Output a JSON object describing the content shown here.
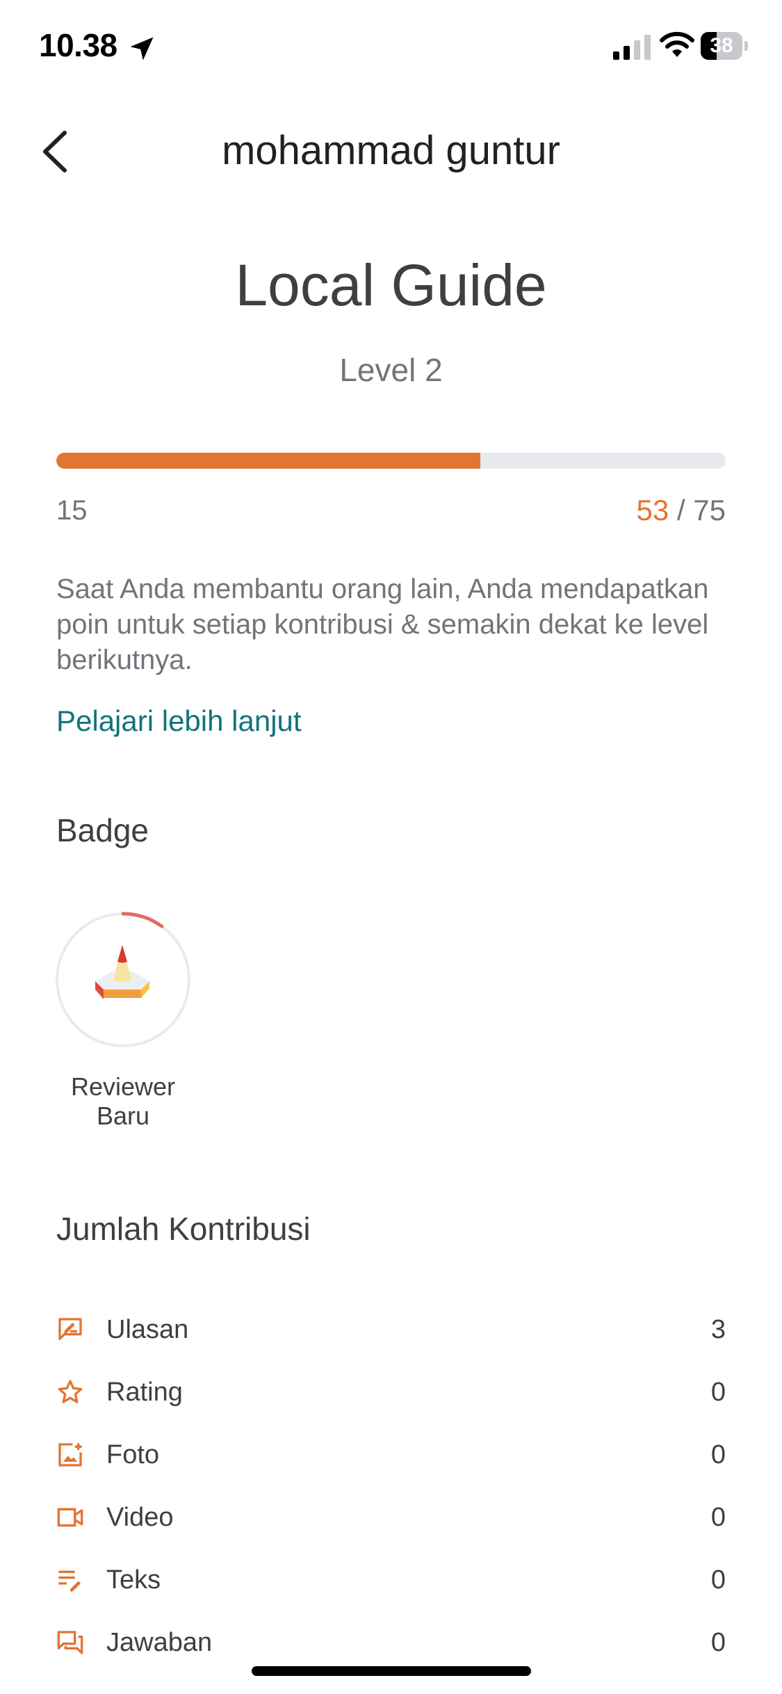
{
  "status_bar": {
    "time": "10.38",
    "battery": "38",
    "battery_level": 0.38
  },
  "header": {
    "title": "mohammad guntur"
  },
  "guide": {
    "title": "Local Guide",
    "level": "Level 2",
    "progress": {
      "min": "15",
      "current": "53",
      "separator": "/",
      "max": "75",
      "fraction": 0.633
    },
    "description": "Saat Anda membantu orang lain, Anda mendapatkan poin untuk setiap kontribusi & semakin dekat ke level berikutnya.",
    "learn_more": "Pelajari lebih lanjut"
  },
  "badges": {
    "title": "Badge",
    "items": [
      {
        "label_line1": "Reviewer",
        "label_line2": "Baru",
        "icon": "reviewer-badge-icon",
        "progress_fraction": 0.1
      }
    ]
  },
  "contributions": {
    "title": "Jumlah Kontribusi",
    "accent": "#e37434",
    "items": [
      {
        "label": "Ulasan",
        "value": "3",
        "icon": "review-icon"
      },
      {
        "label": "Rating",
        "value": "0",
        "icon": "star-icon"
      },
      {
        "label": "Foto",
        "value": "0",
        "icon": "photo-add-icon"
      },
      {
        "label": "Video",
        "value": "0",
        "icon": "video-icon"
      },
      {
        "label": "Teks",
        "value": "0",
        "icon": "text-edit-icon"
      },
      {
        "label": "Jawaban",
        "value": "0",
        "icon": "answer-icon"
      }
    ]
  },
  "colors": {
    "accent": "#e37434",
    "link": "#11737d",
    "track": "#e8eaed"
  }
}
